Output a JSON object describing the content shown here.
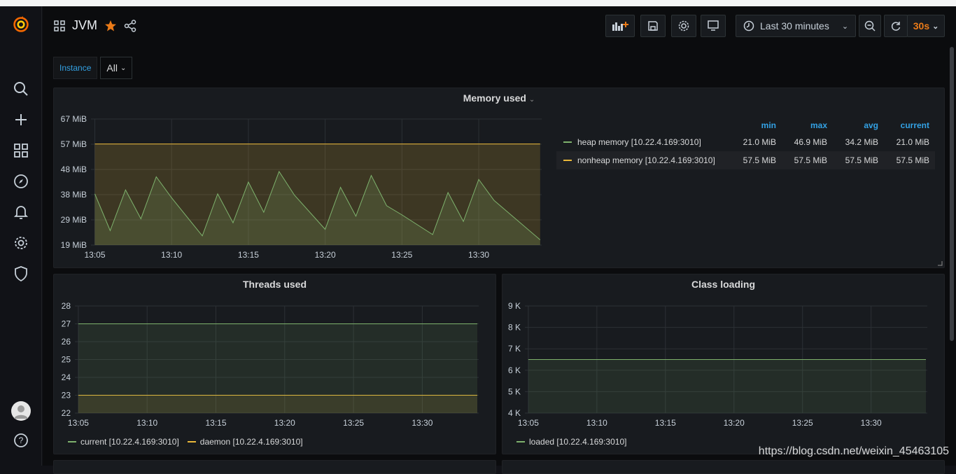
{
  "dashboard": {
    "title": "JVM"
  },
  "toolbar": {
    "time_range": "Last 30 minutes",
    "refresh": "30s"
  },
  "variables": {
    "label": "Instance",
    "value": "All"
  },
  "memory_panel": {
    "title": "Memory used",
    "legend_headers": [
      "min",
      "max",
      "avg",
      "current"
    ],
    "legend_rows": [
      {
        "name": "heap memory [10.22.4.169:3010]",
        "color": "#7eb26d",
        "min": "21.0 MiB",
        "max": "46.9 MiB",
        "avg": "34.2 MiB",
        "current": "21.0 MiB"
      },
      {
        "name": "nonheap memory [10.22.4.169:3010]",
        "color": "#eab839",
        "min": "57.5 MiB",
        "max": "57.5 MiB",
        "avg": "57.5 MiB",
        "current": "57.5 MiB"
      }
    ]
  },
  "threads_panel": {
    "title": "Threads used",
    "legend": [
      {
        "name": "current [10.22.4.169:3010]",
        "color": "#7eb26d"
      },
      {
        "name": "daemon [10.22.4.169:3010]",
        "color": "#eab839"
      }
    ]
  },
  "class_panel": {
    "title": "Class loading",
    "legend": [
      {
        "name": "loaded [10.22.4.169:3010]",
        "color": "#7eb26d"
      }
    ]
  },
  "watermark": "https://blog.csdn.net/weixin_45463105",
  "chart_data": [
    {
      "type": "area",
      "title": "Memory used",
      "x_ticks": [
        "13:05",
        "13:10",
        "13:15",
        "13:20",
        "13:25",
        "13:30"
      ],
      "y_ticks": [
        "19 MiB",
        "29 MiB",
        "38 MiB",
        "48 MiB",
        "57 MiB",
        "67 MiB"
      ],
      "ylim": [
        19,
        67
      ],
      "series": [
        {
          "name": "heap memory [10.22.4.169:3010]",
          "color": "#7eb26d",
          "x": [
            "13:05",
            "13:06",
            "13:07",
            "13:08",
            "13:09",
            "13:10",
            "13:12",
            "13:13",
            "13:14",
            "13:15",
            "13:16",
            "13:17",
            "13:18",
            "13:20",
            "13:21",
            "13:22",
            "13:23",
            "13:24",
            "13:25",
            "13:27",
            "13:28",
            "13:29",
            "13:30",
            "13:31",
            "13:34"
          ],
          "values": [
            38.5,
            24.5,
            40.0,
            29.0,
            45.0,
            37.0,
            22.5,
            38.5,
            27.5,
            43.0,
            31.5,
            47.0,
            38.0,
            25.0,
            41.0,
            30.0,
            45.5,
            34.0,
            30.5,
            23.0,
            39.0,
            28.0,
            44.0,
            36.0,
            21.0
          ]
        },
        {
          "name": "nonheap memory [10.22.4.169:3010]",
          "color": "#eab839",
          "x": [
            "13:05",
            "13:34"
          ],
          "values": [
            57.5,
            57.5
          ]
        }
      ]
    },
    {
      "type": "line",
      "title": "Threads used",
      "x_ticks": [
        "13:05",
        "13:10",
        "13:15",
        "13:20",
        "13:25",
        "13:30"
      ],
      "y_ticks": [
        "22",
        "23",
        "24",
        "25",
        "26",
        "27",
        "28"
      ],
      "ylim": [
        22,
        28
      ],
      "series": [
        {
          "name": "current [10.22.4.169:3010]",
          "color": "#7eb26d",
          "x": [
            "13:05",
            "13:34"
          ],
          "values": [
            27,
            27
          ]
        },
        {
          "name": "daemon [10.22.4.169:3010]",
          "color": "#eab839",
          "x": [
            "13:05",
            "13:34"
          ],
          "values": [
            23,
            23
          ]
        }
      ]
    },
    {
      "type": "area",
      "title": "Class loading",
      "x_ticks": [
        "13:05",
        "13:10",
        "13:15",
        "13:20",
        "13:25",
        "13:30"
      ],
      "y_ticks": [
        "4 K",
        "5 K",
        "6 K",
        "7 K",
        "8 K",
        "9 K"
      ],
      "ylim": [
        4000,
        9000
      ],
      "series": [
        {
          "name": "loaded [10.22.4.169:3010]",
          "color": "#7eb26d",
          "x": [
            "13:05",
            "13:34"
          ],
          "values": [
            6500,
            6500
          ]
        }
      ]
    }
  ]
}
